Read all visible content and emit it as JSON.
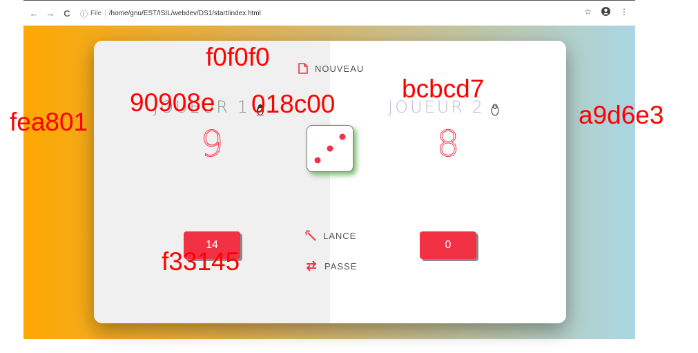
{
  "browser": {
    "back": "←",
    "forward": "→",
    "reload": "C",
    "info": "ⓘ",
    "protocol": "File",
    "url": "/home/gnu/EST/ISIL/webdev/DS1/start/index.html"
  },
  "game": {
    "new_label": "NOUVEAU",
    "roll_label": "LANCE",
    "hold_label": "PASSE",
    "dice_value": 3,
    "players": [
      {
        "name": "JOUEUR 1",
        "score": "9",
        "current": "14"
      },
      {
        "name": "JOUEUR 2",
        "score": "8",
        "current": "0"
      }
    ]
  },
  "annotations": {
    "left_bg": "fea801",
    "right_bg": "a9d6e3",
    "panel_left": "f0f0f0",
    "name_color": "90908e",
    "dice_shadow": "018c00",
    "name_color_2": "bcbcd7",
    "accent": "f33145"
  },
  "colors": {
    "accent": "#f33145",
    "left_panel": "#f0f0f0",
    "right_panel": "#ffffff",
    "gradient_start": "#fea801",
    "gradient_end": "#a9d6e3",
    "label_red": "#ff0000"
  }
}
